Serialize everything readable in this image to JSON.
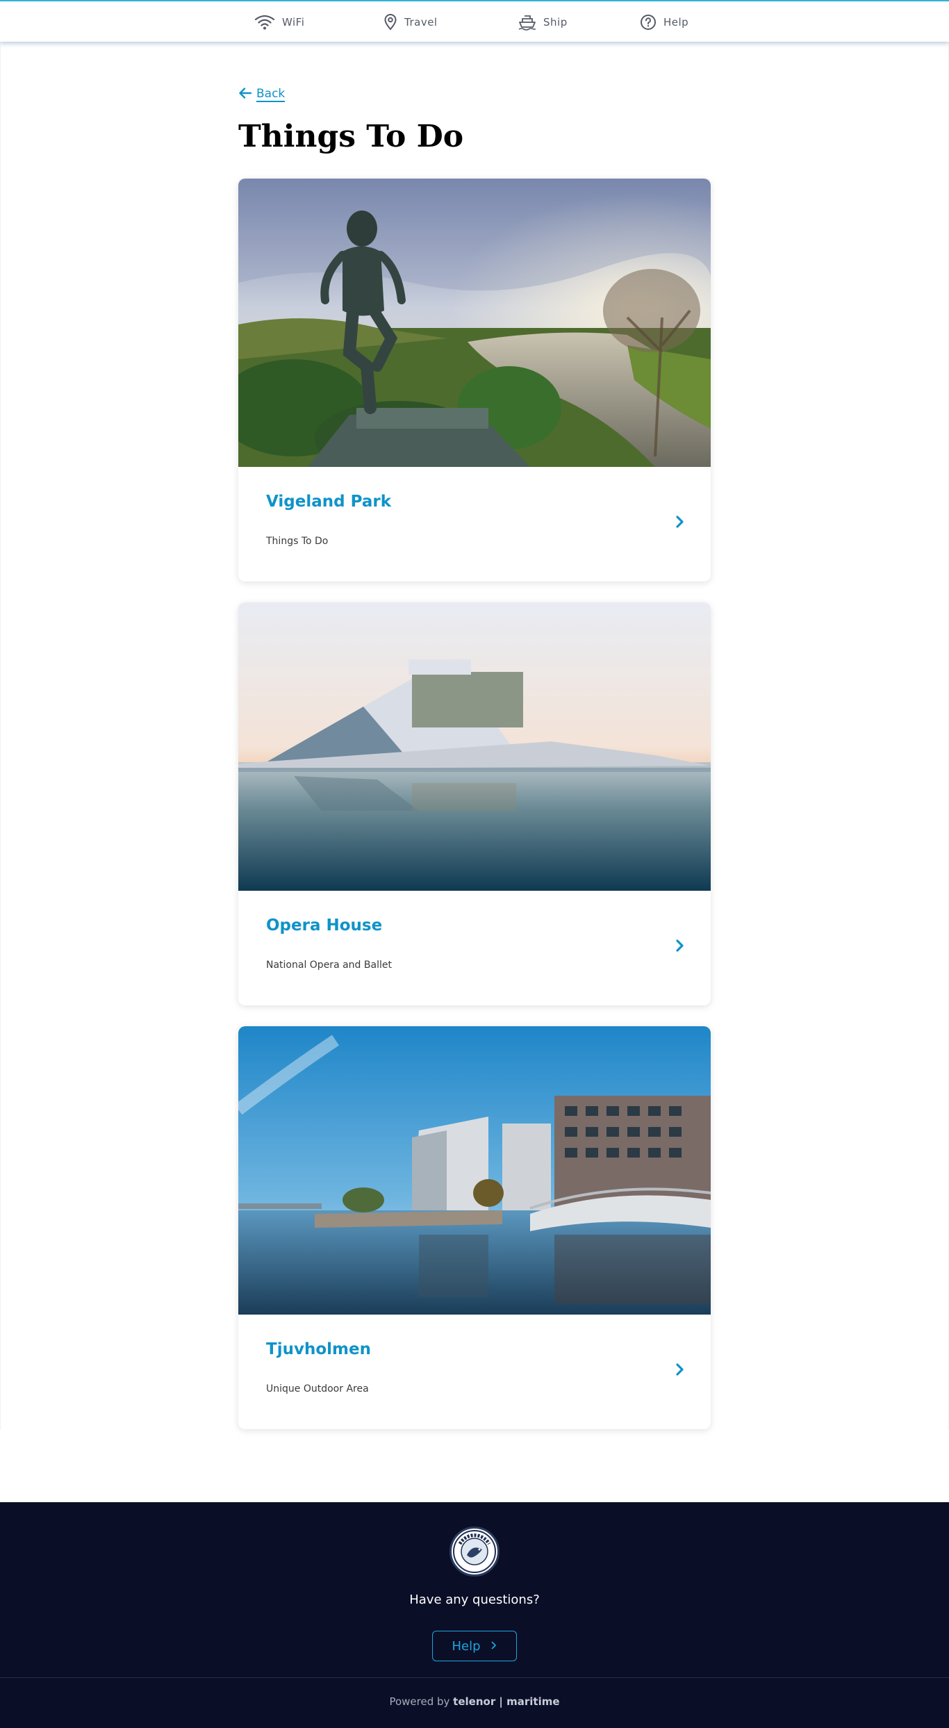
{
  "nav": {
    "items": [
      {
        "label": "WiFi",
        "icon": "wifi-icon"
      },
      {
        "label": "Travel",
        "icon": "map-pin-icon"
      },
      {
        "label": "Ship",
        "icon": "ship-icon"
      },
      {
        "label": "Help",
        "icon": "question-circle-icon"
      }
    ]
  },
  "back": {
    "label": "Back",
    "icon": "arrow-left-icon"
  },
  "page": {
    "title": "Things To Do"
  },
  "cards": [
    {
      "title": "Vigeland Park",
      "subtitle": "Things To Do",
      "image": "statue-park-photo"
    },
    {
      "title": "Opera House",
      "subtitle": "National Opera and Ballet",
      "image": "opera-house-photo"
    },
    {
      "title": "Tjuvholmen",
      "subtitle": "Unique Outdoor Area",
      "image": "waterfront-buildings-photo"
    }
  ],
  "footer": {
    "logo_text": "SMYRIL LINE",
    "question": "Have any questions?",
    "help_label": "Help",
    "powered_prefix": "Powered by",
    "powered_brand": "telenor | maritime"
  },
  "colors": {
    "accent": "#0f93c9",
    "footer_bg": "#0b0e27",
    "nav_border": "#2fb4d6"
  }
}
